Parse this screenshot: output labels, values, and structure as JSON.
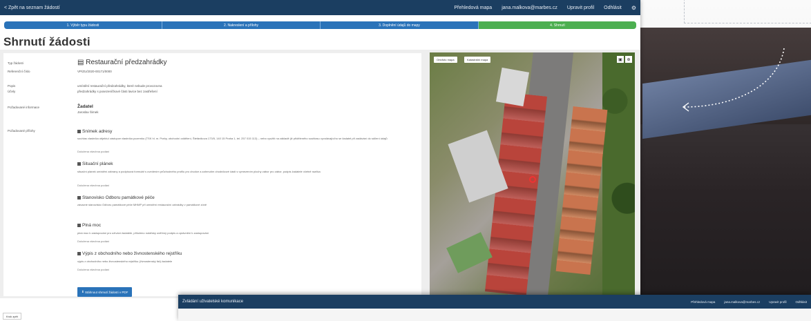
{
  "topbar": {
    "back": "< Zpět na seznam žádostí",
    "nav": [
      "Přehledová mapa",
      "jana.malkova@marbes.cz",
      "Upravit profil",
      "Odhlásit"
    ]
  },
  "steps": [
    "1. Výběr typu žádosti",
    "2. Nakreslení a přílohy",
    "3. Doplnění údajů do mapy",
    "4. Shrnutí"
  ],
  "page_title": "Shrnutí žádosti",
  "summary": {
    "type_label": "Typ žádosti",
    "type_value": "Restaurační předzahrádky",
    "ref_label": "Referenční číslo",
    "ref_value": "VP/ZU/2020-00171/0000",
    "purpose_label": "Popis",
    "purpose_value": "umístění restaurační předzahrádky, které nebude provozovna",
    "place_label": "Účely",
    "place_value": "předzahrádky s posezeníčkové části lavice bez zastřešení",
    "contact_label": "Požadované informace",
    "contact_name": "Žadatel",
    "contact_sub": "Jaroslav Šimek",
    "attachments_label": "Požadované přílohy"
  },
  "sections": [
    {
      "title": "Snímek adresy",
      "text": "souhlas vlastníka objektu/ zástupce vlastníka pozemku (TSK hl. m. Prahy, obchodní oddělení, Štefánikova 173/5, 140 15 Praha 1, tel. 257 015 113) – nebo využití na základě již přiděleného souhlasu vyvolávajícího se žadatel při zadávání do sdílení údajů",
      "link": "Doložena všechna podání"
    },
    {
      "title": "Situační plánek",
      "text": "situační plánek umístění zábrany a podpisová formulář s uvedením průchodného profilu pro chodce a zahrnutím chodníkové části s vymezením plochy zábor pro zábor, podpis žadatele včetně razítka",
      "link": "Doložena všechna podání"
    },
    {
      "title": "Stanovisko Odboru památkové péče",
      "text": "závazné stanovisko Odboru památkové péče MHMP při umístění restaurační zahrádky v památkové zóně",
      "link": ""
    },
    {
      "title": "Plná moc",
      "text": "plná moc k zastupování pro užívání žadatele, přiloženo notářsky ověřený podpis a oprávnění k zastupování",
      "link": "Doložena všechna podání"
    },
    {
      "title": "Výpis z obchodního nebo živnostenského rejstříku",
      "text": "výpis z obchodního nebo živnostenského rejstříku (živnostenský list) žadatele",
      "link": "Doložena všechna podání"
    }
  ],
  "pdf_button": "Stáhnout shrnutí žádosti v PDF",
  "map": {
    "btn1": "Ortofoto mapa",
    "btn2": "Katastrální mapa"
  },
  "footer_button": "Krok zpět",
  "window2": {
    "title": "Zvládání uživatelské komunikace",
    "nav": [
      "Přehledová mapa",
      "jana.malkova@marbes.cz",
      "Upravit profil",
      "Odhlásit"
    ]
  }
}
